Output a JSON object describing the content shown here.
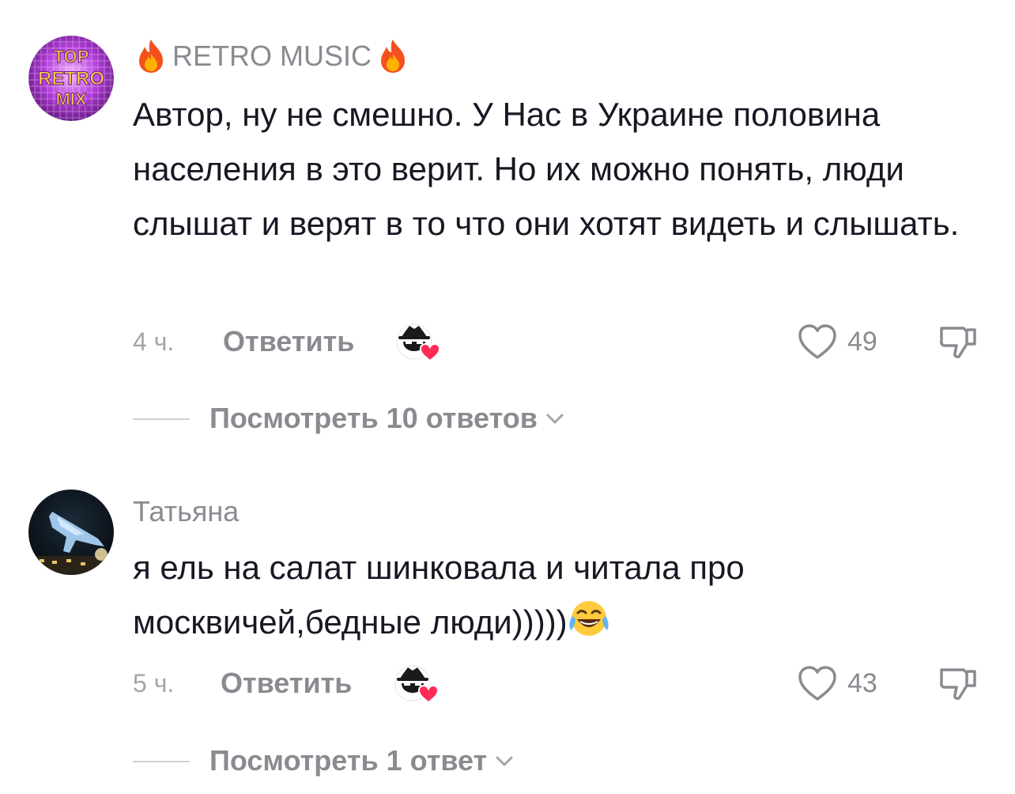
{
  "comments": [
    {
      "avatar_icon": "top-retro-mix-avatar",
      "avatar_text": [
        "TOP",
        "RETRO",
        "MIX"
      ],
      "username": "RETRO MUSIC",
      "username_decor_icon": "fire-emoji",
      "text": "Автор, ну не смешно. У Нас в Украине половина населения в это верит. Но их можно понять, люди слышат и верят в то что они хотят видеть и слышать.",
      "time": "4 ч.",
      "reply_label": "Ответить",
      "creator_like_icon": "creator-liked-icon",
      "like_icon": "heart-outline-icon",
      "like_count": "49",
      "dislike_icon": "thumbs-down-icon",
      "view_replies": "Посмотреть 10 ответов"
    },
    {
      "avatar_icon": "jet-photo-avatar",
      "username": "Татьяна",
      "text": "я ель на салат шинковала и читала про москвичей,бедные люди)))))",
      "text_emoji": "tears-of-joy-emoji",
      "time": "5 ч.",
      "reply_label": "Ответить",
      "creator_like_icon": "creator-liked-icon",
      "like_icon": "heart-outline-icon",
      "like_count": "43",
      "dislike_icon": "thumbs-down-icon",
      "view_replies": "Посмотреть 1 ответ"
    }
  ],
  "colors": {
    "text_primary": "#161823",
    "text_secondary": "#8a8b91",
    "text_tertiary": "#a4a5aa",
    "heart_red": "#fe2c55",
    "divider": "#d0d1d4"
  }
}
